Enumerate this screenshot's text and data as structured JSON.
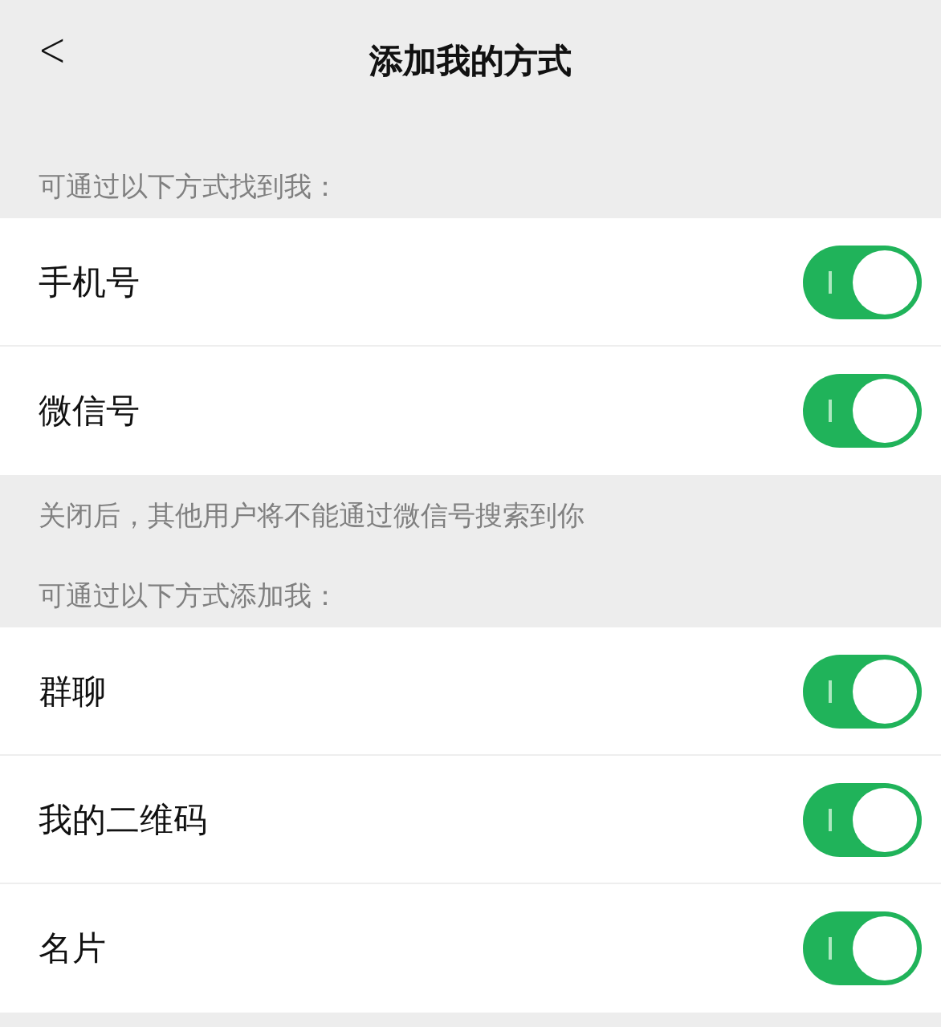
{
  "header": {
    "back": "<",
    "title": "添加我的方式"
  },
  "sections": [
    {
      "label": "可通过以下方式找到我：",
      "items": [
        {
          "label": "手机号",
          "on": true
        },
        {
          "label": "微信号",
          "on": true
        }
      ],
      "note": "关闭后，其他用户将不能通过微信号搜索到你"
    },
    {
      "label": "可通过以下方式添加我：",
      "items": [
        {
          "label": "群聊",
          "on": true
        },
        {
          "label": "我的二维码",
          "on": true
        },
        {
          "label": "名片",
          "on": true
        }
      ]
    }
  ]
}
